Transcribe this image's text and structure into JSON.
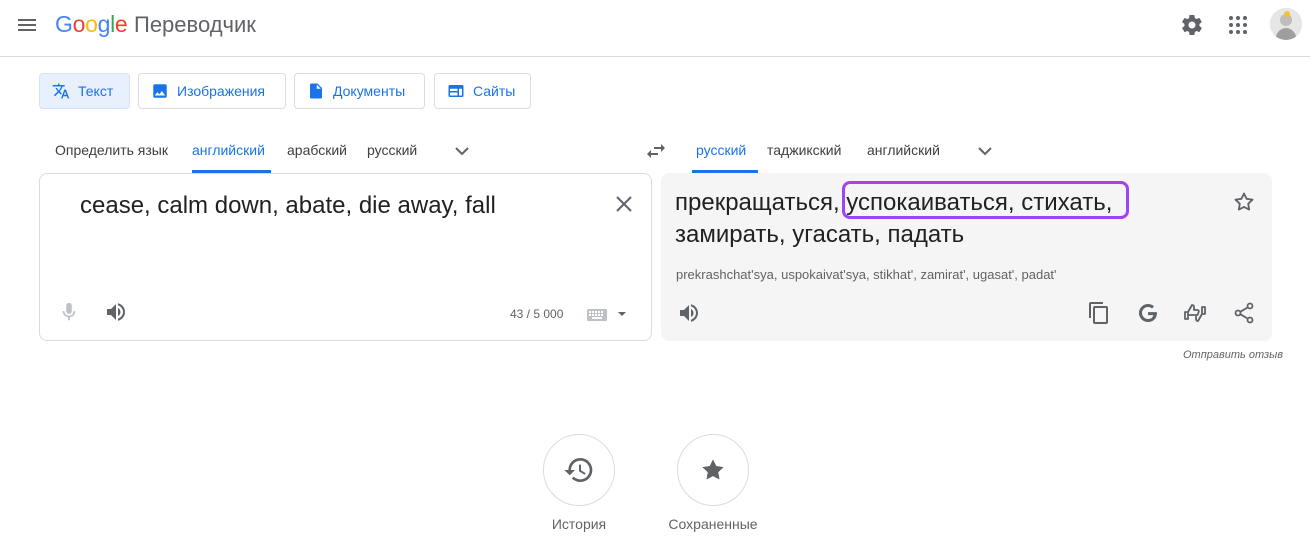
{
  "header": {
    "logo_letters": [
      "G",
      "o",
      "o",
      "g",
      "l",
      "e"
    ],
    "product_name": "Переводчик",
    "icons": {
      "menu": "menu-icon",
      "settings": "gear-icon",
      "apps": "apps-grid-icon",
      "account": "avatar"
    }
  },
  "modes": [
    {
      "label": "Текст",
      "icon": "translate-icon",
      "active": true
    },
    {
      "label": "Изображения",
      "icon": "image-icon",
      "active": false
    },
    {
      "label": "Документы",
      "icon": "document-icon",
      "active": false
    },
    {
      "label": "Сайты",
      "icon": "website-icon",
      "active": false
    }
  ],
  "source_languages": [
    "Определить язык",
    "английский",
    "арабский",
    "русский"
  ],
  "source_selected": "английский",
  "target_languages": [
    "русский",
    "таджикский",
    "английский"
  ],
  "target_selected": "русский",
  "source": {
    "text": "cease, calm down, abate, die away, fall",
    "char_count": "43 / 5 000"
  },
  "target": {
    "text": "прекращаться, успокаиваться, стихать, замирать, угасать, падать",
    "transliteration": "prekrashchat'sya, uspokaivat'sya, stikhat', zamirat', ugasat', padat'",
    "highlight_color": "#a142f4"
  },
  "feedback_label": "Отправить отзыв",
  "bottom": {
    "history_label": "История",
    "saved_label": "Сохраненные"
  },
  "colors": {
    "accent": "#1a73e8",
    "panel_bg": "#f5f5f5",
    "highlight": "#a142f4"
  }
}
